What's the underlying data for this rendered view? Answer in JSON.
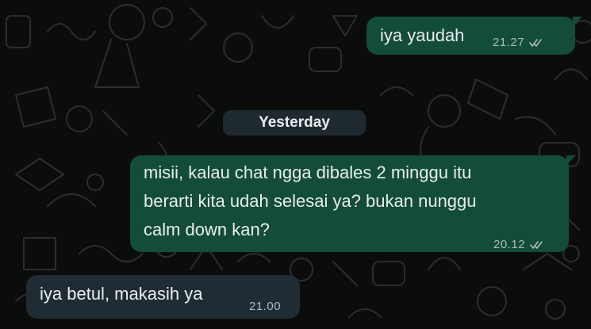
{
  "messages": [
    {
      "direction": "outgoing",
      "text": "iya yaudah",
      "time": "21.27",
      "status": "read"
    },
    {
      "direction": "outgoing",
      "lines": [
        "misii, kalau chat ngga dibales 2 minggu itu",
        "berarti kita udah selesai ya? bukan nunggu",
        "calm down kan?"
      ],
      "time": "20.12",
      "status": "read"
    },
    {
      "direction": "incoming",
      "text": "iya betul, makasih ya",
      "time": "21.00"
    }
  ],
  "day_separator": "Yesterday",
  "colors": {
    "background": "#0b0d0c",
    "outgoing_bubble": "#134d37",
    "incoming_bubble": "#202c33",
    "read_ticks": "#aebac1"
  },
  "icons": {
    "status": "double-check-icon",
    "wallpaper": "doodle-pattern"
  }
}
